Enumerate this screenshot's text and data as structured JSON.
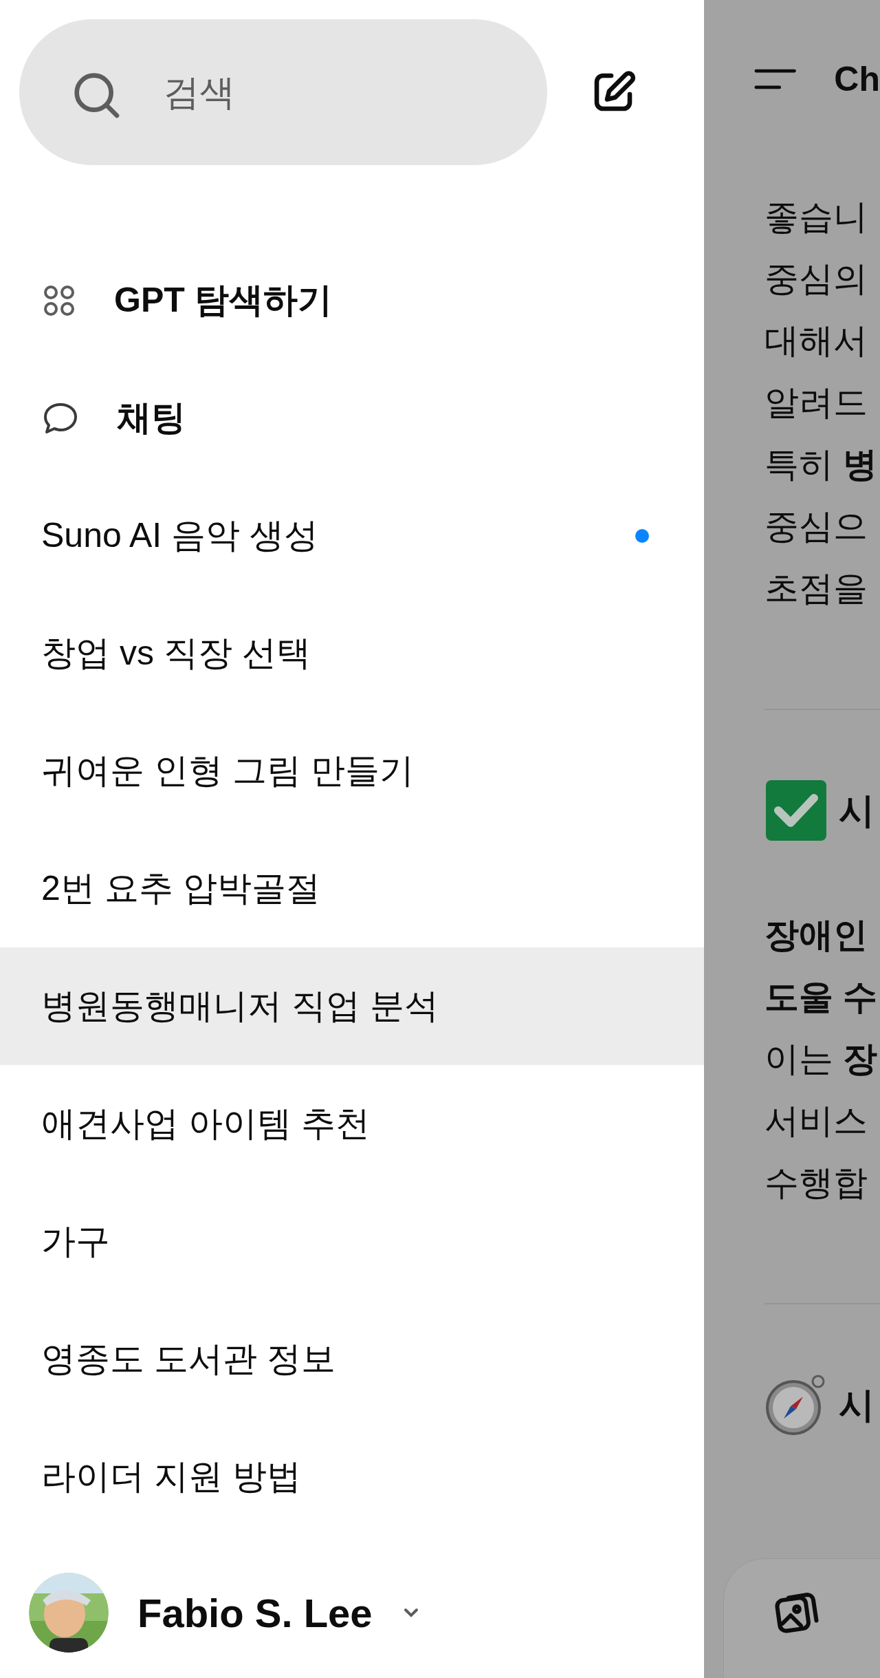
{
  "search": {
    "placeholder": "검색"
  },
  "nav": [
    {
      "label": "GPT 탐색하기",
      "kind": "explore"
    },
    {
      "label": "채팅",
      "kind": "chat"
    }
  ],
  "chats": [
    {
      "title": "Suno AI 음악 생성",
      "selected": false,
      "unread": true
    },
    {
      "title": "창업 vs 직장 선택",
      "selected": false,
      "unread": false
    },
    {
      "title": "귀여운 인형 그림 만들기",
      "selected": false,
      "unread": false
    },
    {
      "title": "2번 요추 압박골절",
      "selected": false,
      "unread": false
    },
    {
      "title": "병원동행매니저 직업 분석",
      "selected": true,
      "unread": false
    },
    {
      "title": "애견사업 아이템 추천",
      "selected": false,
      "unread": false
    },
    {
      "title": "가구",
      "selected": false,
      "unread": false
    },
    {
      "title": "영종도 도서관 정보",
      "selected": false,
      "unread": false
    },
    {
      "title": "라이더 지원 방법",
      "selected": false,
      "unread": false
    }
  ],
  "user": {
    "name": "Fabio S. Lee"
  },
  "main": {
    "title": "Ch",
    "sections": [
      {
        "kind": "text",
        "lines": [
          "좋습니",
          "중심의",
          "대해서",
          "알려드",
          "특히 **병**",
          "중심으",
          "초점을"
        ]
      },
      {
        "kind": "check-heading",
        "text": "시"
      },
      {
        "kind": "text",
        "lines": [
          "**장애인**",
          "**도울 수**",
          "이는 **장**",
          "서비스",
          "수행합"
        ]
      },
      {
        "kind": "compass-heading",
        "text": "시"
      }
    ]
  }
}
